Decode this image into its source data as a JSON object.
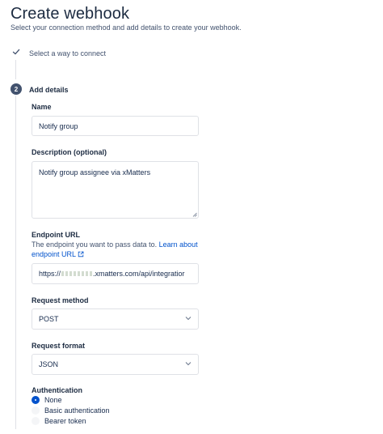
{
  "header": {
    "title": "Create webhook",
    "subtitle": "Select your connection method and add details to create your webhook."
  },
  "steps": [
    {
      "label": "Select a way to connect",
      "state": "complete",
      "icon": "check-icon"
    },
    {
      "number": "2",
      "label": "Add details",
      "state": "current"
    }
  ],
  "form": {
    "name": {
      "label": "Name",
      "value": "Notify group"
    },
    "description": {
      "label": "Description (optional)",
      "value": "Notify group assignee via xMatters"
    },
    "endpoint": {
      "label": "Endpoint URL",
      "help_text": "The endpoint you want to pass data to.",
      "help_link": "Learn about endpoint URL",
      "value_start": "https://",
      "value_end": ".xmatters.com/api/integratior"
    },
    "request_method": {
      "label": "Request method",
      "value": "POST"
    },
    "request_format": {
      "label": "Request format",
      "value": "JSON"
    },
    "authentication": {
      "label": "Authentication",
      "options": [
        "None",
        "Basic authentication",
        "Bearer token"
      ],
      "selected": "None"
    }
  },
  "colors": {
    "link": "#0052cc",
    "selected_radio": "#0052cc",
    "step_badge": "#42526e",
    "text": "#172b4d"
  }
}
